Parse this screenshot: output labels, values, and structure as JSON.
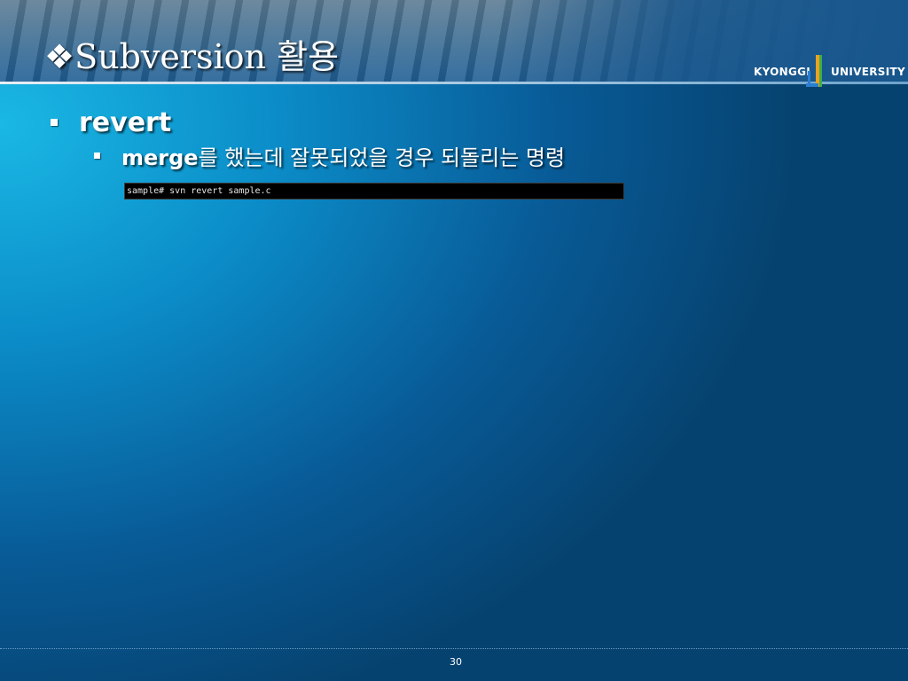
{
  "slide": {
    "title": "❖Subversion 활용",
    "page_number": "30"
  },
  "logo": {
    "left_text": "KYONGGI",
    "right_text": "UNIVERSITY"
  },
  "content": {
    "level1": {
      "text": "revert"
    },
    "level2": {
      "keyword": "merge",
      "text": "를 했는데 잘못되었을 경우 되돌리는 명령"
    },
    "terminal": {
      "command": "sample# svn revert sample.c"
    }
  },
  "colors": {
    "text": "#ffffff",
    "logo_orange": "#f0a020",
    "logo_green": "#3cb04a",
    "logo_blue": "#2a7fd0"
  }
}
